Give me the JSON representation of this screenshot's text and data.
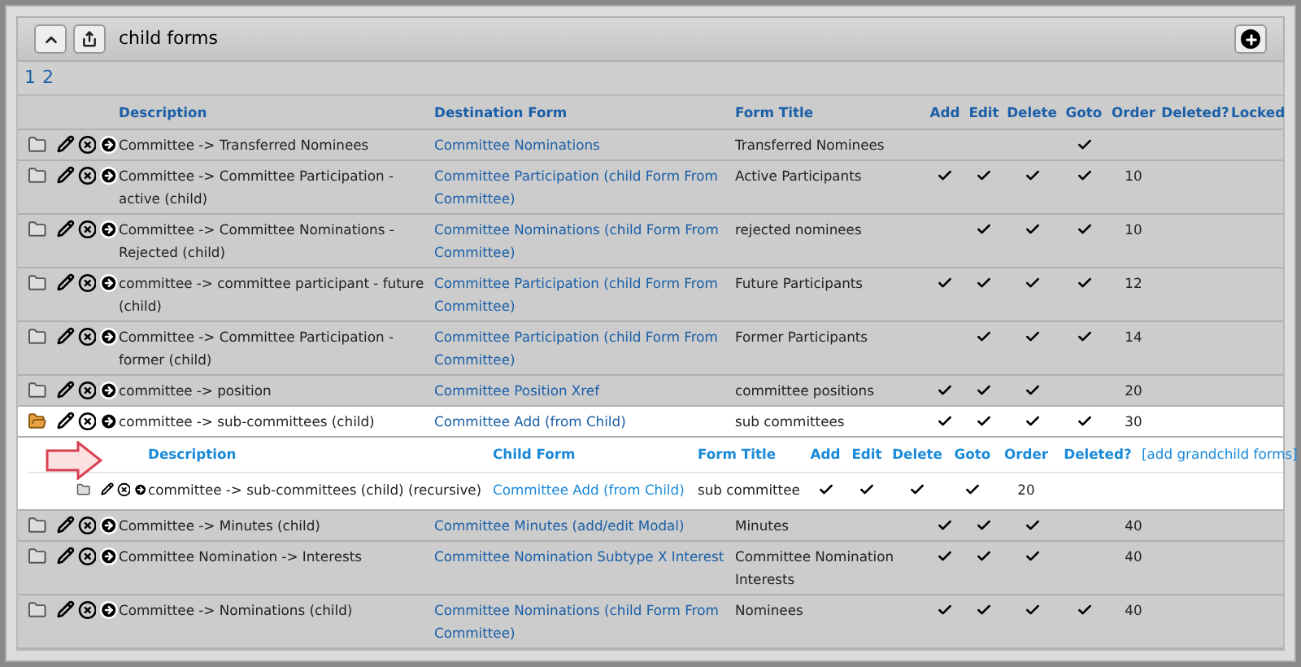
{
  "header": {
    "title": "child forms"
  },
  "pager": [
    {
      "label": "1",
      "selected": false
    },
    {
      "label": "2",
      "selected": false
    }
  ],
  "table": {
    "columns": [
      "Description",
      "Destination Form",
      "Form Title",
      "Add",
      "Edit",
      "Delete",
      "Goto",
      "Order",
      "Deleted?",
      "Locked"
    ],
    "rows": [
      {
        "description": "Committee -> Transferred Nominees",
        "destination": "Committee Nominations",
        "form_title": "Transferred Nominees",
        "add": false,
        "edit": false,
        "delete": false,
        "goto": true,
        "order": "",
        "expanded": false
      },
      {
        "description": "Committee -> Committee Participation - active (child)",
        "destination": "Committee Participation (child Form From Committee)",
        "form_title": "Active Participants",
        "add": true,
        "edit": true,
        "delete": true,
        "goto": true,
        "order": "10",
        "expanded": false
      },
      {
        "description": "Committee -> Committee Nominations - Rejected (child)",
        "destination": "Committee Nominations (child Form From Committee)",
        "form_title": "rejected nominees",
        "add": false,
        "edit": true,
        "delete": true,
        "goto": true,
        "order": "10",
        "expanded": false
      },
      {
        "description": "committee -> committee participant - future (child)",
        "destination": "Committee Participation (child Form From Committee)",
        "form_title": "Future Participants",
        "add": true,
        "edit": true,
        "delete": true,
        "goto": true,
        "order": "12",
        "expanded": false
      },
      {
        "description": "Committee -> Committee Participation - former (child)",
        "destination": "Committee Participation (child Form From Committee)",
        "form_title": "Former Participants",
        "add": false,
        "edit": true,
        "delete": true,
        "goto": true,
        "order": "14",
        "expanded": false
      },
      {
        "description": "committee -> position",
        "destination": "Committee Position Xref",
        "form_title": "committee positions",
        "add": true,
        "edit": true,
        "delete": true,
        "goto": false,
        "order": "20",
        "expanded": false
      },
      {
        "description": "committee -> sub-committees (child)",
        "destination": "Committee Add (from Child)",
        "form_title": "sub committees",
        "add": true,
        "edit": true,
        "delete": true,
        "goto": true,
        "order": "30",
        "expanded": true,
        "children": {
          "columns": [
            "Description",
            "Child Form",
            "Form Title",
            "Add",
            "Edit",
            "Delete",
            "Goto",
            "Order",
            "Deleted?"
          ],
          "add_link": "[add grandchild forms]",
          "rows": [
            {
              "description": "committee -> sub-committees (child) (recursive)",
              "child_form": "Committee Add (from Child)",
              "form_title": "sub committee",
              "add": true,
              "edit": true,
              "delete": true,
              "goto": true,
              "order": "20"
            }
          ]
        }
      },
      {
        "description": "Committee -> Minutes (child)",
        "destination": "Committee Minutes (add/edit Modal)",
        "form_title": "Minutes",
        "add": true,
        "edit": true,
        "delete": true,
        "goto": false,
        "order": "40",
        "expanded": false
      },
      {
        "description": "Committee Nomination -> Interests",
        "destination": "Committee Nomination Subtype X Interest",
        "form_title": "Committee Nomination Interests",
        "add": true,
        "edit": true,
        "delete": true,
        "goto": false,
        "order": "40",
        "expanded": false
      },
      {
        "description": "Committee -> Nominations (child)",
        "destination": "Committee Nominations (child Form From Committee)",
        "form_title": "Nominees",
        "add": true,
        "edit": true,
        "delete": true,
        "goto": true,
        "order": "40",
        "expanded": false
      }
    ]
  }
}
